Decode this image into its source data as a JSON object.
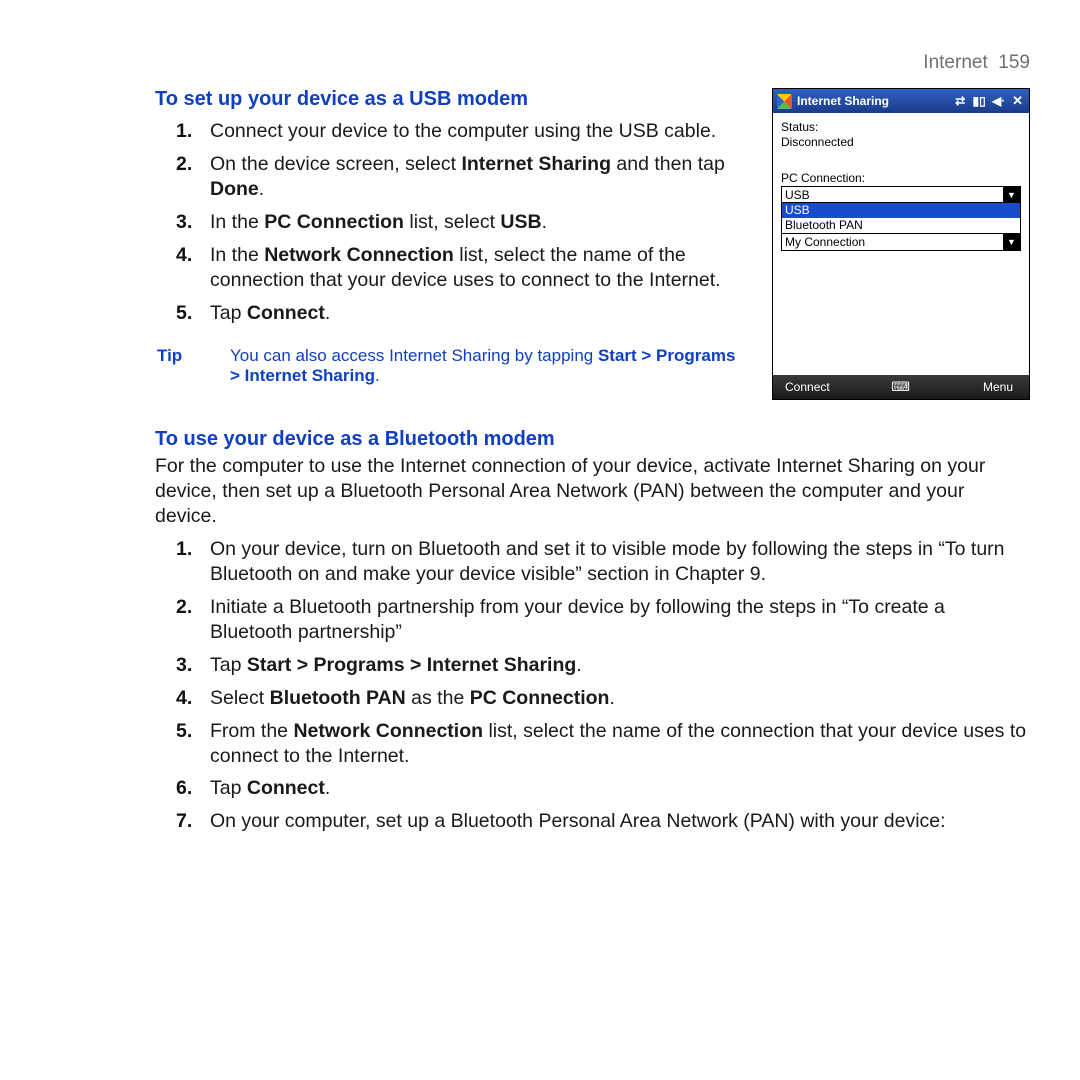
{
  "header": {
    "chapter": "Internet",
    "page": "159"
  },
  "section1": {
    "heading": "To set up your device as a USB modem",
    "steps": [
      {
        "n": "1.",
        "text": "Connect your device to the computer using the USB cable."
      },
      {
        "n": "2.",
        "pre": "On the device screen, select ",
        "b1": "Internet Sharing",
        "mid": " and then tap ",
        "b2": "Done",
        "post": "."
      },
      {
        "n": "3.",
        "pre": "In the ",
        "b1": "PC Connection",
        "mid": " list, select ",
        "b2": "USB",
        "post": "."
      },
      {
        "n": "4.",
        "pre": "In the ",
        "b1": "Network Connection",
        "post": " list, select the name of the connection that your device uses to connect to the Internet."
      },
      {
        "n": "5.",
        "pre": "Tap ",
        "b1": "Connect",
        "post": "."
      }
    ],
    "tip_label": "Tip",
    "tip_pre": "You can also access Internet Sharing by tapping ",
    "tip_bold": "Start > Programs > Internet Sharing",
    "tip_post": "."
  },
  "section2": {
    "heading": "To use your device as a Bluetooth modem",
    "intro": "For the computer to use the Internet connection of your device, activate Internet Sharing on your device, then set up a Bluetooth Personal Area Network (PAN) between the computer and your device.",
    "steps": [
      {
        "n": "1.",
        "text": "On your device, turn on Bluetooth and set it to visible mode by following the steps in “To turn Bluetooth on and make your device visible” section in Chapter 9."
      },
      {
        "n": "2.",
        "text": "Initiate a Bluetooth partnership from your device by following the steps in “To create a Bluetooth partnership”"
      },
      {
        "n": "3.",
        "pre": "Tap ",
        "b1": "Start > Programs > Internet Sharing",
        "post": "."
      },
      {
        "n": "4.",
        "pre": "Select ",
        "b1": "Bluetooth PAN",
        "mid": " as the ",
        "b2": "PC Connection",
        "post": "."
      },
      {
        "n": "5.",
        "pre": "From the ",
        "b1": "Network Connection",
        "post": " list, select the name of the connection that your device uses to connect to the Internet."
      },
      {
        "n": "6.",
        "pre": "Tap ",
        "b1": "Connect",
        "post": "."
      },
      {
        "n": "7.",
        "text": "On your computer, set up a Bluetooth Personal Area Network (PAN) with your device:"
      }
    ]
  },
  "device": {
    "title": "Internet Sharing",
    "status_label": "Status:",
    "status_value": "Disconnected",
    "pc_label": "PC Connection:",
    "pc_value": "USB",
    "pc_options": [
      "USB",
      "Bluetooth PAN"
    ],
    "net_value": "My Connection",
    "softkey_left": "Connect",
    "softkey_right": "Menu",
    "kb_glyph": "⌨"
  }
}
